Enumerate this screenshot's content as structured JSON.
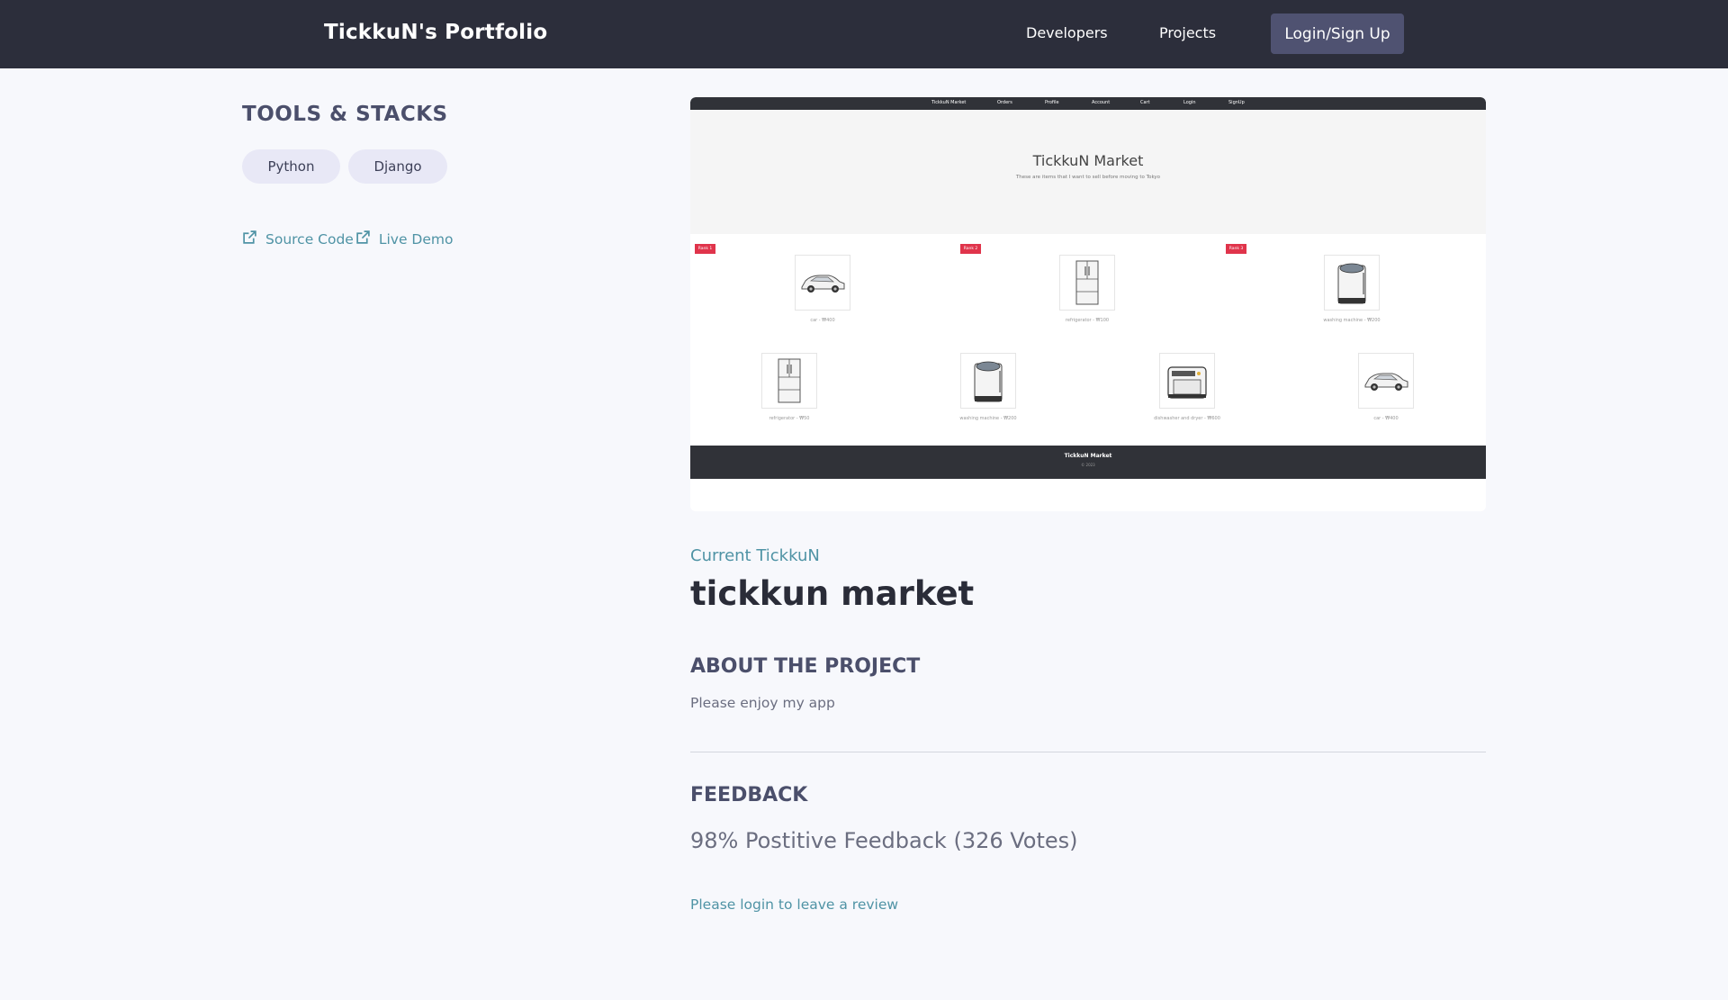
{
  "header": {
    "brand": "TickkuN's Portfolio",
    "nav": {
      "developers": "Developers",
      "projects": "Projects"
    },
    "login_label": "Login/Sign Up"
  },
  "sidebar": {
    "tools_title": "TOOLS & STACKS",
    "chips": [
      "Python",
      "Django"
    ],
    "links": {
      "source_code": "Source Code",
      "live_demo": "Live Demo"
    }
  },
  "preview": {
    "nav_items": [
      "TickkuN Market",
      "Orders",
      "Profile",
      "Account",
      "Cart",
      "Login",
      "SignUp"
    ],
    "title": "TickkuN Market",
    "subtitle": "These are items that I want to sell before moving to Tokyo",
    "badges": [
      "Rank 1",
      "Rank 2",
      "Rank 3"
    ],
    "items": [
      {
        "icon": "car-icon",
        "caption": "car - ₩400"
      },
      {
        "icon": "refrigerator-icon",
        "caption": "refrigerator - ₩100"
      },
      {
        "icon": "washing-machine-icon",
        "caption": "washing machine - ₩200"
      },
      {
        "icon": "refrigerator-icon",
        "caption": "refrigerator - ₩50"
      },
      {
        "icon": "washing-machine-icon",
        "caption": "washing machine - ₩200"
      },
      {
        "icon": "dishwasher-icon",
        "caption": "dishwasher and dryer - ₩600"
      },
      {
        "icon": "car-icon",
        "caption": "car - ₩400"
      }
    ],
    "footer_title": "TickkuN Market",
    "footer_sub": "© 2023"
  },
  "main": {
    "eyebrow": "Current TickkuN",
    "project_title": "tickkun market",
    "about_heading": "ABOUT THE PROJECT",
    "about_text": "Please enjoy my app",
    "feedback_heading": "FEEDBACK",
    "feedback_stat": "98% Postitive Feedback (326 Votes)",
    "review_link": "Please login to leave a review"
  },
  "colors": {
    "nav_bg": "#2c2e3b",
    "accent": "#4f93a5",
    "button_bg": "#4f5271",
    "chip_bg": "#e8e8f6",
    "page_bg": "#f7f8fc",
    "badge_red": "#e0344b"
  }
}
